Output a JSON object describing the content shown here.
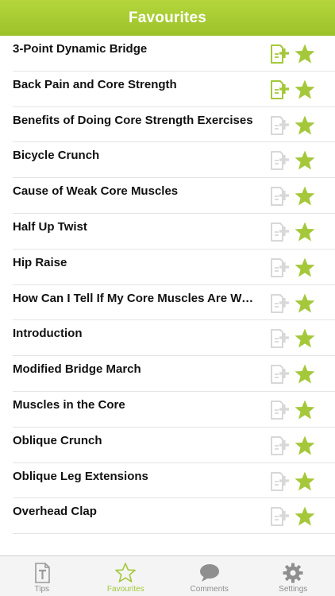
{
  "header": {
    "title": "Favourites"
  },
  "colors": {
    "accent": "#a4c83a",
    "note_active": "#a4c83a",
    "note_inactive": "#d8d8d8"
  },
  "items": [
    {
      "title": "3-Point Dynamic Bridge",
      "note_active": true
    },
    {
      "title": "Back Pain and Core Strength",
      "note_active": true
    },
    {
      "title": "Benefits of Doing Core Strength Exercises",
      "note_active": false
    },
    {
      "title": "Bicycle Crunch",
      "note_active": false
    },
    {
      "title": "Cause of Weak Core Muscles",
      "note_active": false
    },
    {
      "title": "Half Up Twist",
      "note_active": false
    },
    {
      "title": "Hip Raise",
      "note_active": false
    },
    {
      "title": "How Can I Tell If My Core Muscles Are Weak?",
      "note_active": false
    },
    {
      "title": "Introduction",
      "note_active": false
    },
    {
      "title": "Modified Bridge March",
      "note_active": false
    },
    {
      "title": "Muscles in the Core",
      "note_active": false
    },
    {
      "title": "Oblique Crunch",
      "note_active": false
    },
    {
      "title": "Oblique Leg Extensions",
      "note_active": false
    },
    {
      "title": "Overhead Clap",
      "note_active": false
    }
  ],
  "tabs": [
    {
      "label": "Tips",
      "icon": "document-t-icon",
      "active": false
    },
    {
      "label": "Favourites",
      "icon": "star-outline-icon",
      "active": true
    },
    {
      "label": "Comments",
      "icon": "speech-bubble-icon",
      "active": false
    },
    {
      "label": "Settings",
      "icon": "gear-icon",
      "active": false
    }
  ]
}
